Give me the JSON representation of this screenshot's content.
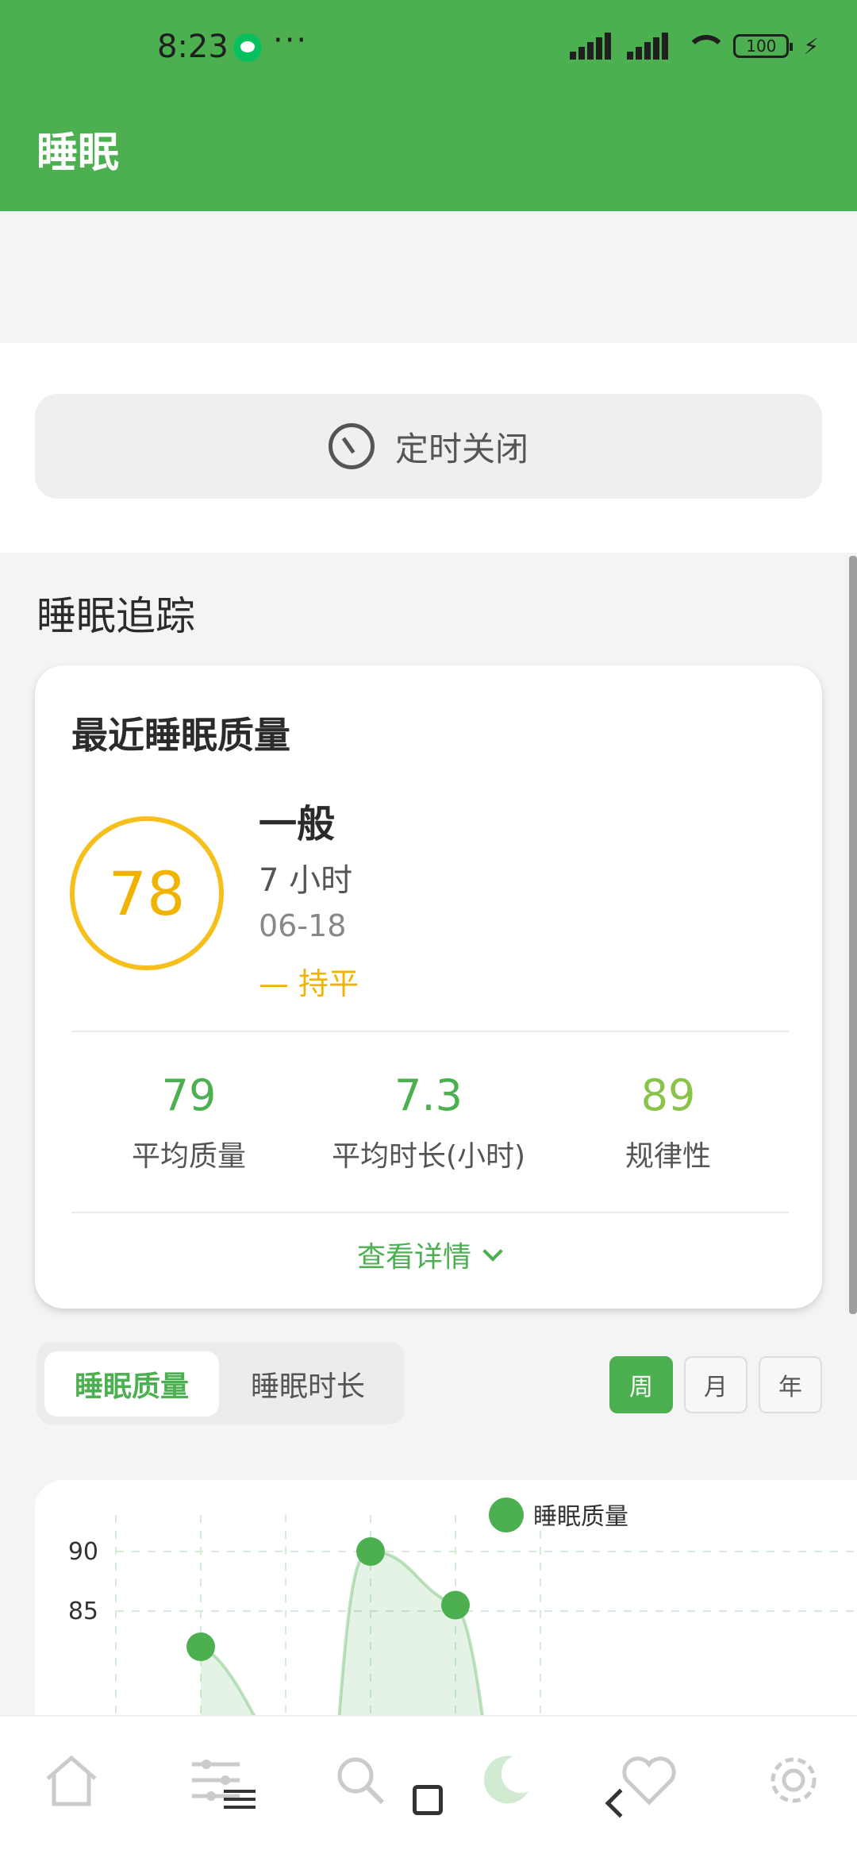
{
  "status_bar": {
    "time": "8:23",
    "dots": "···",
    "battery": "100",
    "icons": [
      "wechat-icon",
      "signal-hd-icon",
      "signal-hd-icon",
      "wifi-icon",
      "battery-icon",
      "charging-icon"
    ]
  },
  "app_bar": {
    "title": "睡眠"
  },
  "timer": {
    "label": "定时关闭",
    "icon": "timer-icon"
  },
  "tracking": {
    "section_title": "睡眠追踪",
    "card_title": "最近睡眠质量",
    "score": "78",
    "quality_label": "一般",
    "duration": "7 小时",
    "date": "06-18",
    "trend": "— 持平",
    "stats": [
      {
        "value": "79",
        "label": "平均质量"
      },
      {
        "value": "7.3",
        "label": "平均时长(小时)"
      },
      {
        "value": "89",
        "label": "规律性"
      }
    ],
    "details": "查看详情"
  },
  "tabs": [
    {
      "label": "睡眠质量",
      "selected": true
    },
    {
      "label": "睡眠时长",
      "selected": false
    }
  ],
  "periods": [
    {
      "label": "周",
      "selected": true
    },
    {
      "label": "月",
      "selected": false
    },
    {
      "label": "年",
      "selected": false
    }
  ],
  "colors": {
    "primary": "#4caf50",
    "score": "#f5c01c",
    "regularity": "#8bc34a"
  },
  "chart_data": {
    "type": "area",
    "series": [
      {
        "name": "睡眠质量",
        "points": [
          {
            "x": 2,
            "y": 82
          },
          {
            "x": 4,
            "y": 90
          },
          {
            "x": 5,
            "y": 85.5
          }
        ]
      }
    ],
    "yticks": [
      90,
      85
    ],
    "ylim": [
      80,
      92
    ],
    "grid": true,
    "legend": "top-center"
  },
  "bottom_nav": {
    "icons": [
      "home-icon",
      "filter-icon",
      "search-icon",
      "moon-icon",
      "heart-icon",
      "settings-icon"
    ]
  }
}
